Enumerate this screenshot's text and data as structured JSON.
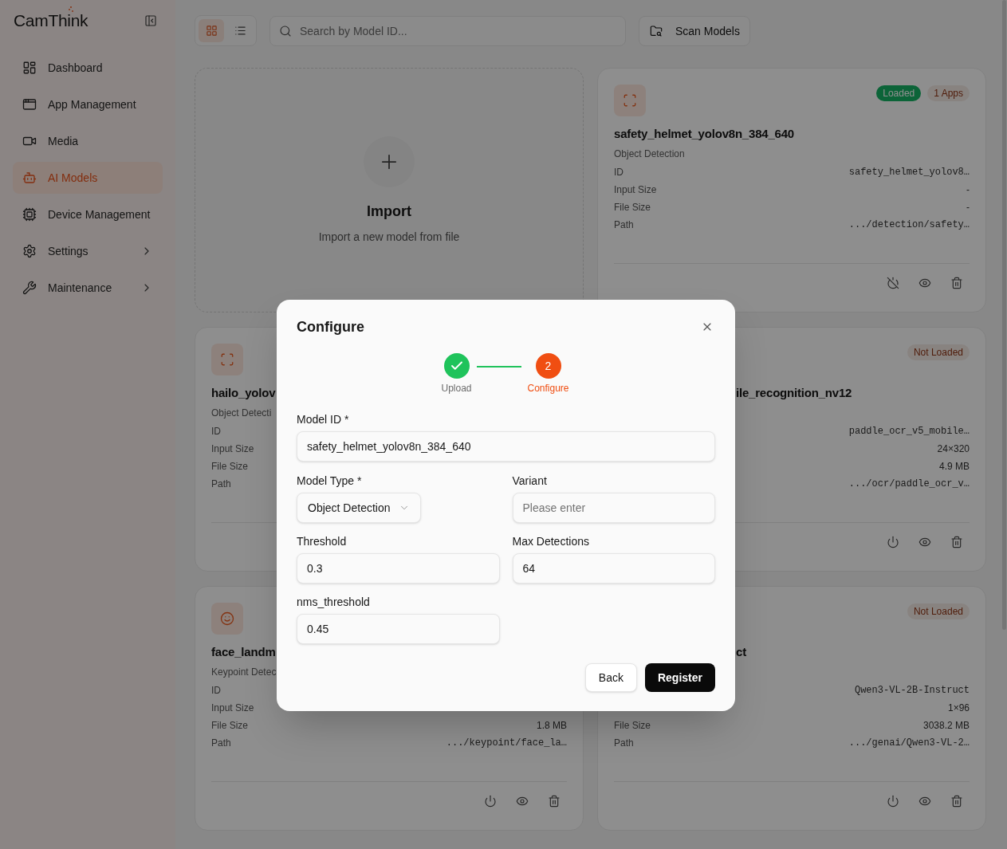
{
  "sidebar": {
    "logo": "CamThink",
    "items": [
      {
        "label": "Dashboard",
        "kind": "dashboard",
        "selected": false,
        "submenu": false
      },
      {
        "label": "App Management",
        "kind": "app",
        "selected": false,
        "submenu": false
      },
      {
        "label": "Media",
        "kind": "media",
        "selected": false,
        "submenu": false
      },
      {
        "label": "AI Models",
        "kind": "bot",
        "selected": true,
        "submenu": false
      },
      {
        "label": "Device Management",
        "kind": "chip",
        "selected": false,
        "submenu": false
      },
      {
        "label": "Settings",
        "kind": "settings",
        "selected": false,
        "submenu": true
      },
      {
        "label": "Maintenance",
        "kind": "wrench",
        "selected": false,
        "submenu": true
      }
    ]
  },
  "toolbar": {
    "view_modes": [
      {
        "kind": "grid",
        "selected": true
      },
      {
        "kind": "list",
        "selected": false
      }
    ],
    "search": {
      "placeholder": "Search by Model ID..."
    },
    "scan_button": {
      "label": "Scan Models"
    }
  },
  "import_card": {
    "title": "Import",
    "subtitle": "Import a new model from file"
  },
  "model_cards": [
    {
      "kind": "scan",
      "badges": [
        {
          "label": "Loaded",
          "kind": "loaded"
        },
        {
          "label": "1 Apps",
          "kind": "count"
        }
      ],
      "title": "safety_helmet_yolov8n_384_640",
      "subtitle": "Object Detection",
      "rows": [
        {
          "label": "ID",
          "value": "safety_helmet_yolov8…",
          "kind": "code"
        },
        {
          "label": "Input Size",
          "value": "-",
          "kind": "text"
        },
        {
          "label": "File Size",
          "value": "-",
          "kind": "text"
        },
        {
          "label": "Path",
          "value": ".../detection/safety…",
          "kind": "code"
        }
      ],
      "actions": [
        {
          "kind": "power_off"
        },
        {
          "kind": "view"
        },
        {
          "kind": "delete"
        }
      ]
    },
    {
      "kind": "scan",
      "title": "hailo_yolov",
      "subtitle": "Object Detecti",
      "rows": [
        {
          "label": "ID"
        },
        {
          "label": "Input Size"
        },
        {
          "label": "File Size"
        },
        {
          "label": "Path"
        }
      ]
    },
    {
      "badges": [
        {
          "label": "Not Loaded",
          "kind": "not_loaded"
        }
      ],
      "title": "ile_recognition_nv12",
      "rows": [
        {
          "value": "paddle_ocr_v5_mobile…",
          "kind": "code"
        },
        {
          "value": "24×320",
          "kind": "text"
        },
        {
          "value": "4.9 MB",
          "kind": "text"
        },
        {
          "value": ".../ocr/paddle_ocr_v…",
          "kind": "code"
        }
      ],
      "actions": [
        {
          "kind": "power"
        },
        {
          "kind": "view"
        },
        {
          "kind": "delete"
        }
      ]
    },
    {
      "kind": "face",
      "title": "face_landm",
      "subtitle": "Keypoint Detec",
      "rows": [
        {
          "label": "ID"
        },
        {
          "label": "Input Size"
        },
        {
          "label": "File Size",
          "value": "1.8 MB",
          "kind": "text"
        },
        {
          "label": "Path",
          "value": ".../keypoint/face_la…",
          "kind": "code"
        }
      ],
      "actions": [
        {
          "kind": "power"
        },
        {
          "kind": "view"
        },
        {
          "kind": "delete"
        }
      ]
    },
    {
      "badges": [
        {
          "label": "Not Loaded",
          "kind": "not_loaded"
        }
      ],
      "title": "ct",
      "rows": [
        {
          "value": "Qwen3-VL-2B-Instruct",
          "kind": "code"
        },
        {
          "value": "1×96",
          "kind": "text"
        },
        {
          "label": "File Size",
          "value": "3038.2 MB",
          "kind": "text"
        },
        {
          "label": "Path",
          "value": ".../genai/Qwen3-VL-2…",
          "kind": "code"
        }
      ],
      "actions": [
        {
          "kind": "power"
        },
        {
          "kind": "view"
        },
        {
          "kind": "delete"
        }
      ]
    }
  ],
  "dialog": {
    "title": "Configure",
    "steps": [
      {
        "label": "Upload",
        "completed": true,
        "selected": false
      },
      {
        "label": "Configure",
        "number": "2",
        "completed": false,
        "selected": true
      }
    ],
    "model_id": {
      "label": "Model ID *",
      "value": "safety_helmet_yolov8n_384_640"
    },
    "fields": [
      {
        "kind": "select",
        "label": "Model Type *",
        "value": "Object Detection"
      },
      {
        "kind": "text",
        "label": "Variant",
        "placeholder": "Please enter"
      },
      {
        "kind": "text",
        "label": "Threshold",
        "value": "0.3"
      },
      {
        "kind": "text",
        "label": "Max Detections",
        "value": "64"
      },
      {
        "kind": "text",
        "label": "nms_threshold",
        "value": "0.45"
      }
    ],
    "buttons": [
      {
        "label": "Back",
        "kind": "secondary"
      },
      {
        "label": "Register",
        "kind": "primary"
      }
    ]
  }
}
